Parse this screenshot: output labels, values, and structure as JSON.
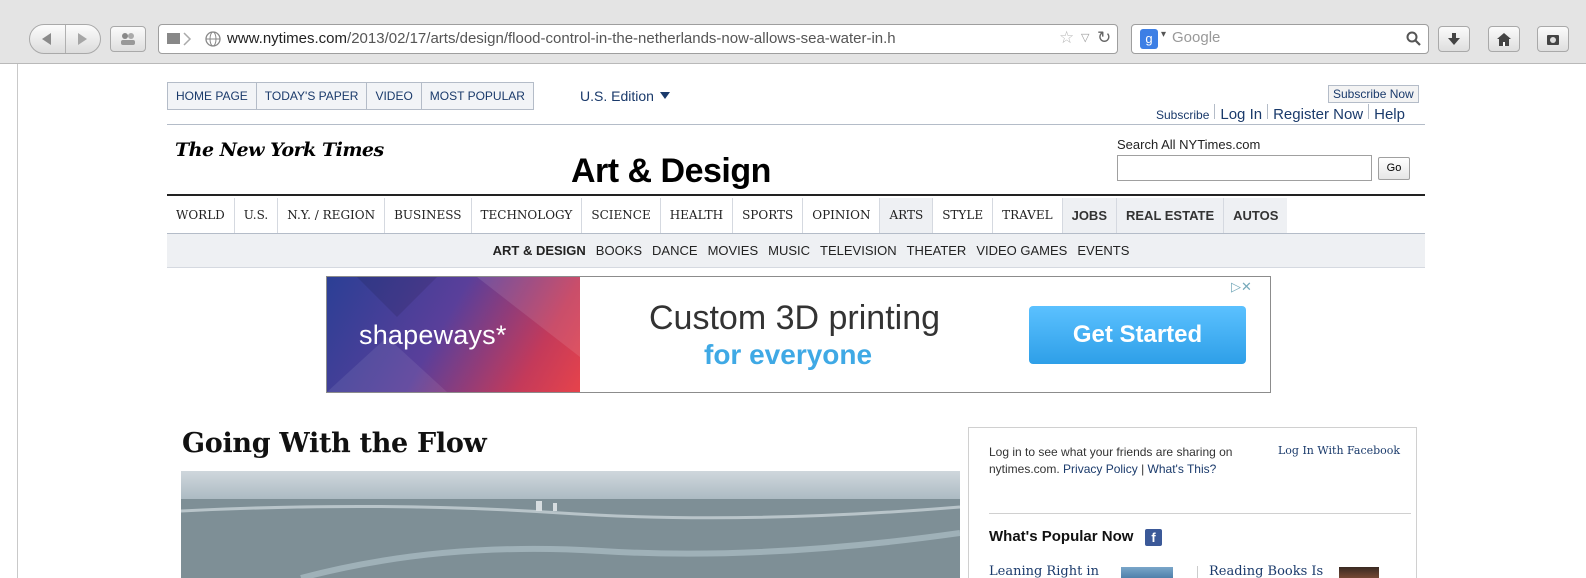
{
  "browser": {
    "url_domain": "www.nytimes.com",
    "url_path": "/2013/02/17/arts/design/flood-control-in-the-netherlands-now-allows-sea-water-in.h",
    "search_engine": "Google"
  },
  "topnav": {
    "items": [
      "HOME PAGE",
      "TODAY'S PAPER",
      "VIDEO",
      "MOST POPULAR"
    ],
    "edition": "U.S. Edition"
  },
  "account": {
    "subscribe_now": "Subscribe Now",
    "subscribe": "Subscribe",
    "log_in": "Log In",
    "register_now": "Register Now",
    "help": "Help"
  },
  "masthead": {
    "logo": "The New York Times",
    "section": "Art & Design",
    "search_label": "Search All NYTimes.com",
    "go": "Go"
  },
  "sections": [
    "WORLD",
    "U.S.",
    "N.Y. / REGION",
    "BUSINESS",
    "TECHNOLOGY",
    "SCIENCE",
    "HEALTH",
    "SPORTS",
    "OPINION",
    "ARTS",
    "STYLE",
    "TRAVEL",
    "JOBS",
    "REAL ESTATE",
    "AUTOS"
  ],
  "subsections": [
    "ART & DESIGN",
    "BOOKS",
    "DANCE",
    "MOVIES",
    "MUSIC",
    "TELEVISION",
    "THEATER",
    "VIDEO GAMES",
    "EVENTS"
  ],
  "ad": {
    "brand": "shapeways*",
    "headline_1": "Custom 3D printing",
    "headline_2": "for everyone",
    "cta": "Get Started"
  },
  "article": {
    "headline": "Going With the Flow"
  },
  "sidebar": {
    "friends_text": "Log in to see what your friends are sharing on nytimes.com.",
    "privacy_link": "Privacy Policy",
    "separator": "|",
    "whats_this": "What's This?",
    "fb_login": "Log In With Facebook",
    "popular_heading": "What's Popular Now",
    "popular_item_1": "Leaning Right in",
    "popular_item_2": "Reading Books Is"
  }
}
